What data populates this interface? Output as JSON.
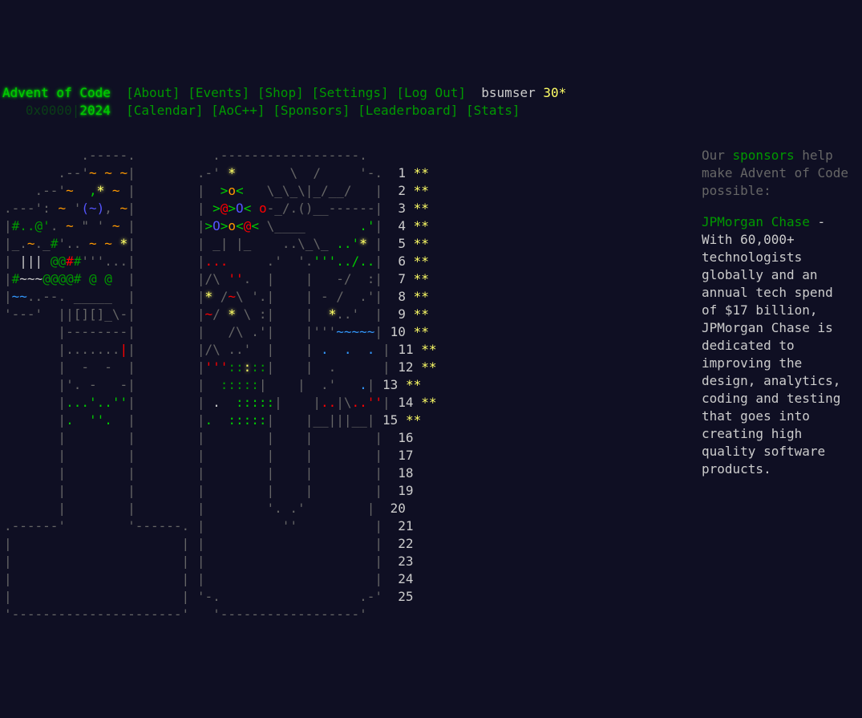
{
  "header": {
    "title": "Advent of Code",
    "nav_top": [
      "[About]",
      "[Events]",
      "[Shop]",
      "[Settings]",
      "[Log Out]"
    ],
    "user": "bsumser",
    "star_count": "30*",
    "year_prefix": "0x0000|",
    "year": "2024",
    "nav_bottom": [
      "[Calendar]",
      "[AoC++]",
      "[Sponsors]",
      "[Leaderboard]",
      "[Stats]"
    ]
  },
  "calendar": {
    "days": [
      {
        "day": "1",
        "stars": "**"
      },
      {
        "day": "2",
        "stars": "**"
      },
      {
        "day": "3",
        "stars": "**"
      },
      {
        "day": "4",
        "stars": "**"
      },
      {
        "day": "5",
        "stars": "**"
      },
      {
        "day": "6",
        "stars": "**"
      },
      {
        "day": "7",
        "stars": "**"
      },
      {
        "day": "8",
        "stars": "**"
      },
      {
        "day": "9",
        "stars": "**"
      },
      {
        "day": "10",
        "stars": "**"
      },
      {
        "day": "11",
        "stars": "**"
      },
      {
        "day": "12",
        "stars": "**"
      },
      {
        "day": "13",
        "stars": "**"
      },
      {
        "day": "14",
        "stars": "**"
      },
      {
        "day": "15",
        "stars": "**"
      },
      {
        "day": "16",
        "stars": ""
      },
      {
        "day": "17",
        "stars": ""
      },
      {
        "day": "18",
        "stars": ""
      },
      {
        "day": "19",
        "stars": ""
      },
      {
        "day": "20",
        "stars": ""
      },
      {
        "day": "21",
        "stars": ""
      },
      {
        "day": "22",
        "stars": ""
      },
      {
        "day": "23",
        "stars": ""
      },
      {
        "day": "24",
        "stars": ""
      },
      {
        "day": "25",
        "stars": ""
      }
    ]
  },
  "sidebar": {
    "intro_before": "Our ",
    "intro_link": "sponsors",
    "intro_after": " help make Advent of Code possible:",
    "sponsor_name": "JPMorgan Chase",
    "sponsor_text": " - With 60,000+ technologists globally and an annual tech spend of $17 billion, JPMorgan Chase is dedicated to improving the design, analytics, coding and testing that goes into creating high quality software products."
  },
  "colors": {
    "background": "#0f0f23",
    "text": "#cccccc",
    "link": "#009900",
    "title": "#00cc00",
    "gold": "#ffff66"
  }
}
